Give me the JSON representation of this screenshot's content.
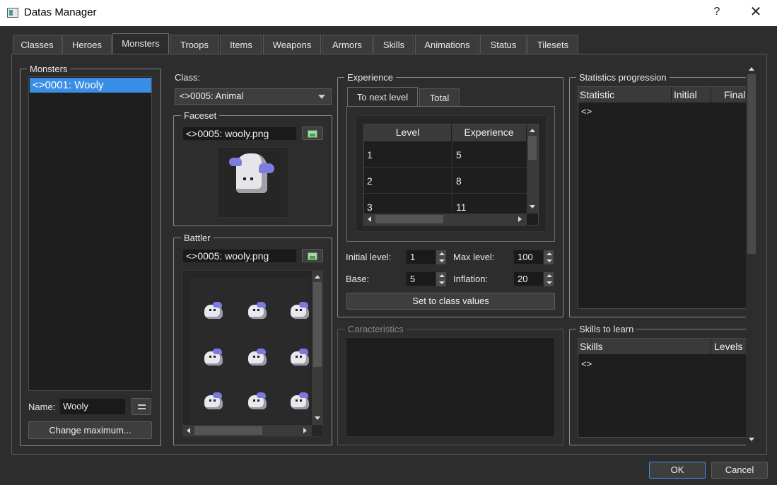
{
  "window": {
    "title": "Datas Manager",
    "help": "?",
    "close": "✕"
  },
  "tabs": [
    "Classes",
    "Heroes",
    "Monsters",
    "Troops",
    "Items",
    "Weapons",
    "Armors",
    "Skills",
    "Animations",
    "Status",
    "Tilesets"
  ],
  "monsters": {
    "group_title": "Monsters",
    "list": [
      "<>0001: Wooly"
    ],
    "name_label": "Name:",
    "name_value": "Wooly",
    "change_maximum": "Change maximum..."
  },
  "class": {
    "label": "Class:",
    "selected": "<>0005: Animal"
  },
  "faceset": {
    "title": "Faceset",
    "file": "<>0005: wooly.png"
  },
  "battler": {
    "title": "Battler",
    "file": "<>0005: wooly.png"
  },
  "experience": {
    "title": "Experience",
    "tabs": [
      "To next level",
      "Total"
    ],
    "headers": [
      "Level",
      "Experience"
    ],
    "rows": [
      [
        "1",
        "5"
      ],
      [
        "2",
        "8"
      ],
      [
        "3",
        "11"
      ]
    ],
    "initial_level_label": "Initial level:",
    "initial_level": "1",
    "max_level_label": "Max level:",
    "max_level": "100",
    "base_label": "Base:",
    "base": "5",
    "inflation_label": "Inflation:",
    "inflation": "20",
    "set_class_values": "Set to class values"
  },
  "characteristics": {
    "title": "Caracteristics"
  },
  "statistics": {
    "title": "Statistics progression",
    "headers": [
      "Statistic",
      "Initial",
      "Final"
    ],
    "rows": [
      "<>"
    ]
  },
  "skills": {
    "title": "Skills to learn",
    "headers": [
      "Skills",
      "Levels"
    ],
    "rows": [
      "<>"
    ]
  },
  "footer": {
    "ok": "OK",
    "cancel": "Cancel"
  },
  "colors": {
    "background": "#2d2d2d",
    "selection": "#3a8ee6",
    "list_bg": "#1e1e1e"
  }
}
